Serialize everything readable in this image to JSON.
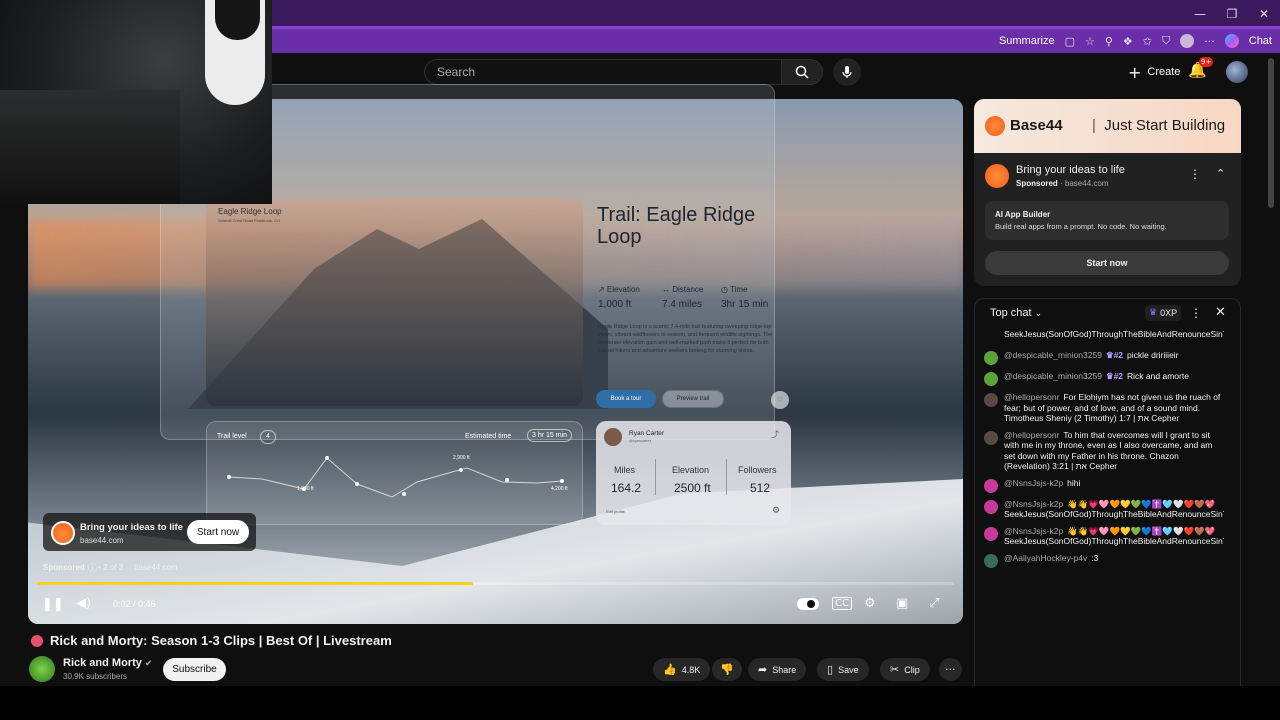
{
  "browser": {
    "summarize_label": "Summarize",
    "chat_label": "Chat",
    "window_controls": [
      "—",
      "❐",
      "✕"
    ]
  },
  "header": {
    "search_placeholder": "Search",
    "create_label": "Create",
    "notification_badge": "9+"
  },
  "video": {
    "overlay": {
      "photo_title": "Eagle Ridge Loop",
      "photo_subtitle": "Summit Crest Road Pinebrook, CO",
      "trail_title": "Trail: Eagle Ridge Loop",
      "stats": [
        {
          "label": "↗ Elevation",
          "value": "1,000 ft"
        },
        {
          "label": "↔ Distance",
          "value": "7.4 miles"
        },
        {
          "label": "◷ Time",
          "value": "3hr 15 min"
        }
      ],
      "description": "Eagle Ridge Loop is a scenic 7.4-mile trail featuring sweeping ridge-top views, vibrant wildflowers in season, and frequent wildlife sightings. The moderate elevation gain and well-marked path make it perfect for both casual hikers and adventure seekers looking for stunning vistas.",
      "book_label": "Book a tour",
      "preview_label": "Preview trail",
      "trail_level_label": "Trail level",
      "trail_level_value": "4",
      "estimated_label": "Estimated time",
      "estimated_value": "3 hr 15 min",
      "chart_labels": [
        "1,000 ft",
        "2,900 ft",
        "4,200 ft"
      ],
      "profile_name": "Ryan Carter",
      "profile_handle": "@ryancarter",
      "profile_stats": [
        {
          "label": "Miles",
          "value": "164.2"
        },
        {
          "label": "Elevation",
          "value": "2500 ft"
        },
        {
          "label": "Followers",
          "value": "512"
        }
      ],
      "edit_profile": "Edit profile"
    },
    "ad": {
      "headline": "Bring your ideas to life",
      "domain": "base44.com",
      "start_label": "Start now",
      "sponsored_label": "Sponsored",
      "position": "• 2 of 3",
      "domain2": "base44.com"
    },
    "time": "0:02 / 0:46",
    "progress": 0.475
  },
  "watch": {
    "title": "Rick and Morty: Season 1-3 Clips | Best Of | Livestream",
    "channel": "Rick and Morty",
    "subscribers": "30.9K subscribers",
    "subscribe_label": "Subscribe",
    "likes": "4.8K",
    "share_label": "Share",
    "save_label": "Save",
    "clip_label": "Clip"
  },
  "side_ad": {
    "brand": "Base44",
    "tagline": "Just Start Building",
    "headline": "Bring your ideas to life",
    "sponsored": "Sponsored",
    "domain": "· base44.com",
    "box_title": "AI App Builder",
    "box_body": "Build real apps from a prompt. No code. No waiting.",
    "start_label": "Start now"
  },
  "chat": {
    "header": "Top chat",
    "xp": "0XP",
    "messages": [
      {
        "name": "",
        "badge": "",
        "text": "SeekJesus(SonOfGod)ThroughTheBibleAndRenounceSinToReceiveEternalHeaven,BecauseTimeIsRunningOut!",
        "color": "#0f0f0f"
      },
      {
        "name": "@despicable_minion3259",
        "badge": "#2",
        "text": "pickle dririiieir",
        "color": "#5aa43a"
      },
      {
        "name": "@despicable_minion3259",
        "badge": "#2",
        "text": "Rick and amorte",
        "color": "#5aa43a"
      },
      {
        "name": "@hellopersonr",
        "badge": "",
        "text": "For Elohiym has not given us the ruach of fear; but of power, and of love, and of a sound mind. Timotheus Sheniy (2 Timothy) 1:7 | את Cepher",
        "color": "#5b4a44"
      },
      {
        "name": "@hellopersonr",
        "badge": "",
        "text": "To him that overcomes will I grant to sit with me in my throne, even as I also overcame, and am set down with my Father in his throne. Chazon (Revelation) 3:21 | את Cepher",
        "color": "#5b4a44"
      },
      {
        "name": "@NsnsJsjs-k2p",
        "badge": "",
        "text": "hihi",
        "color": "#c43b9a"
      },
      {
        "name": "@NsnsJsjs-k2p",
        "badge": "",
        "text": "👋👋💗🩷🧡💛💚💙✝️🩵🤍❤️🤎💖 SeekJesus(SonOfGod)ThroughTheBibleAndRenounceSinToReceiveEternalHeaven,BecauseTimeIsRunningOut!",
        "color": "#c43b9a"
      },
      {
        "name": "@NsnsJsjs-k2p",
        "badge": "",
        "text": "👋👋💗🩷🧡💛💚💙✝️🩵🤍❤️🤎💖 SeekJesus(SonOfGod)ThroughTheBibleAndRenounceSinToReceiveEternalHeaven,BecauseTimeIsRunningOut!",
        "color": "#c43b9a"
      },
      {
        "name": "@AaliyahHockley-p4v",
        "badge": "",
        "text": ":3",
        "color": "#3b6c5a"
      }
    ]
  }
}
